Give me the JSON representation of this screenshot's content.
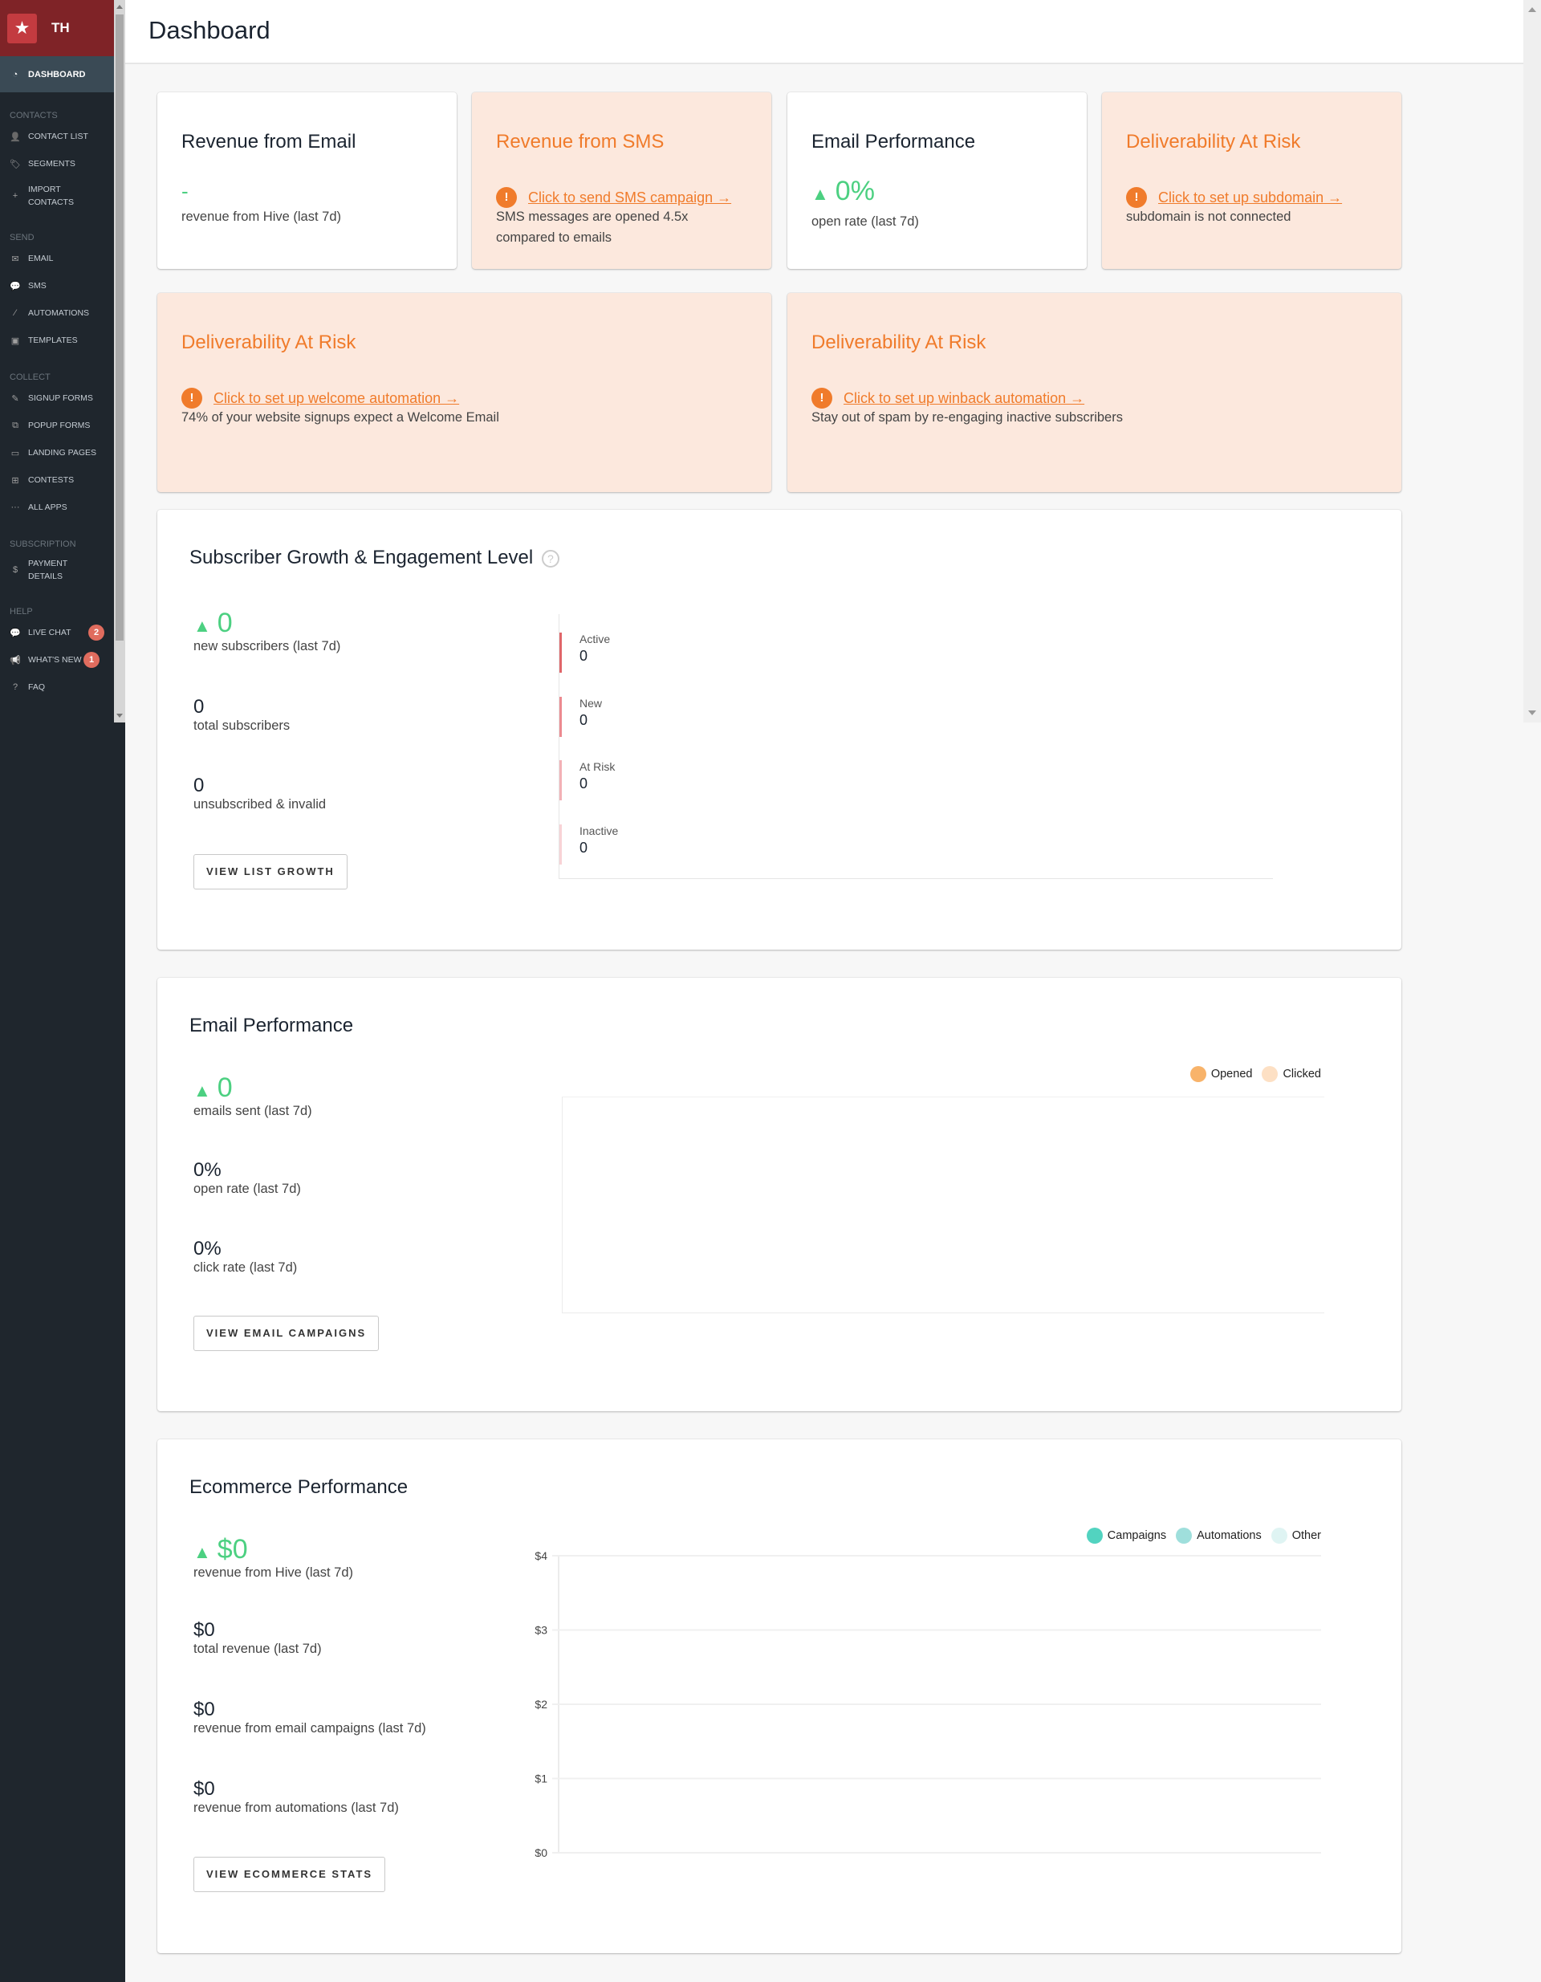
{
  "brand": {
    "initials": "TH",
    "logo_icon": "star-icon"
  },
  "sidebar": {
    "active": {
      "label": "DASHBOARD",
      "icon": "dashboard-gauge-icon"
    },
    "sections": [
      {
        "title": "CONTACTS",
        "items": [
          {
            "label": "CONTACT LIST",
            "icon": "user-icon"
          },
          {
            "label": "SEGMENTS",
            "icon": "tags-icon"
          },
          {
            "label": "IMPORT CONTACTS",
            "label_lines": [
              "IMPORT",
              "CONTACTS"
            ],
            "icon": "user-plus-icon"
          }
        ]
      },
      {
        "title": "SEND",
        "items": [
          {
            "label": "EMAIL",
            "icon": "envelope-icon"
          },
          {
            "label": "SMS",
            "icon": "chat-bubble-icon"
          },
          {
            "label": "AUTOMATIONS",
            "icon": "magic-wand-icon"
          },
          {
            "label": "TEMPLATES",
            "icon": "image-file-icon"
          }
        ]
      },
      {
        "title": "COLLECT",
        "items": [
          {
            "label": "SIGNUP FORMS",
            "icon": "edit-form-icon"
          },
          {
            "label": "POPUP FORMS",
            "icon": "popup-window-icon"
          },
          {
            "label": "LANDING PAGES",
            "icon": "browser-window-icon"
          },
          {
            "label": "CONTESTS",
            "icon": "gift-icon"
          },
          {
            "label": "ALL APPS",
            "icon": "ellipsis-icon"
          }
        ]
      },
      {
        "title": "SUBSCRIPTION",
        "items": [
          {
            "label": "PAYMENT DETAILS",
            "label_lines": [
              "PAYMENT",
              "DETAILS"
            ],
            "icon": "dollar-icon"
          }
        ]
      },
      {
        "title": "HELP",
        "items": [
          {
            "label": "LIVE CHAT",
            "icon": "chat-bubble-icon",
            "badge": "2"
          },
          {
            "label": "WHAT'S NEW",
            "icon": "megaphone-icon",
            "badge": "1"
          },
          {
            "label": "FAQ",
            "icon": "question-icon"
          }
        ]
      }
    ]
  },
  "header": {
    "title": "Dashboard"
  },
  "top_cards": [
    {
      "title": "Revenue from Email",
      "value": "-",
      "label": "revenue from Hive (last 7d)",
      "warn": false
    },
    {
      "title": "Revenue from SMS",
      "link": "Click to send SMS campaign →",
      "desc": "SMS messages are opened 4.5x compared to emails",
      "warn": true
    },
    {
      "title": "Email Performance",
      "value": "0%",
      "label": "open rate (last 7d)",
      "warn": false
    },
    {
      "title": "Deliverability At Risk",
      "link": "Click to set up subdomain →",
      "desc": "subdomain is not connected",
      "warn": true
    }
  ],
  "wide_cards": [
    {
      "title": "Deliverability At Risk",
      "link": "Click to set up welcome automation →",
      "desc": "74% of your website signups expect a Welcome Email"
    },
    {
      "title": "Deliverability At Risk",
      "link": "Click to set up winback automation →",
      "desc": "Stay out of spam by re-engaging inactive subscribers"
    }
  ],
  "subscriber": {
    "title": "Subscriber Growth & Engagement Level",
    "help_icon": "question-circle-icon",
    "stats": [
      {
        "value": "0",
        "label": "new subscribers (last 7d)",
        "trend": "up"
      },
      {
        "value": "0",
        "label": "total subscribers"
      },
      {
        "value": "0",
        "label": "unsubscribed & invalid"
      }
    ],
    "button": "VIEW LIST GROWTH",
    "engagement": [
      {
        "label": "Active",
        "value": "0",
        "color": "#e0666a"
      },
      {
        "label": "New",
        "value": "0",
        "color": "#ec8a90"
      },
      {
        "label": "At Risk",
        "value": "0",
        "color": "#f3b1b6"
      },
      {
        "label": "Inactive",
        "value": "0",
        "color": "#f8d3d6"
      }
    ]
  },
  "email_perf": {
    "title": "Email Performance",
    "stats": [
      {
        "value": "0",
        "label": "emails sent (last 7d)",
        "trend": "up"
      },
      {
        "value": "0%",
        "label": "open rate (last 7d)"
      },
      {
        "value": "0%",
        "label": "click rate (last 7d)"
      }
    ],
    "button": "VIEW EMAIL CAMPAIGNS",
    "legend": [
      {
        "label": "Opened",
        "color": "#f8b36a"
      },
      {
        "label": "Clicked",
        "color": "#fde0c4"
      }
    ]
  },
  "ecommerce": {
    "title": "Ecommerce Performance",
    "stats": [
      {
        "value": "$0",
        "label": "revenue from Hive (last 7d)",
        "trend": "up"
      },
      {
        "value": "$0",
        "label": "total revenue (last 7d)"
      },
      {
        "value": "$0",
        "label": "revenue from email campaigns (last 7d)"
      },
      {
        "value": "$0",
        "label": "revenue from automations (last 7d)"
      }
    ],
    "button": "VIEW ECOMMERCE STATS",
    "legend": [
      {
        "label": "Campaigns",
        "color": "#52d3c0"
      },
      {
        "label": "Automations",
        "color": "#9fdfdc"
      },
      {
        "label": "Other",
        "color": "#dff4f3"
      }
    ]
  },
  "chart_data": [
    {
      "type": "bar",
      "title": "Email Performance",
      "series": [
        {
          "name": "Opened",
          "values": []
        },
        {
          "name": "Clicked",
          "values": []
        }
      ],
      "categories": [],
      "legend": "top-right",
      "grid": false
    },
    {
      "type": "bar",
      "title": "Ecommerce Performance",
      "series": [
        {
          "name": "Campaigns",
          "values": []
        },
        {
          "name": "Automations",
          "values": []
        },
        {
          "name": "Other",
          "values": []
        }
      ],
      "categories": [],
      "yticks": [
        "$0",
        "$1",
        "$2",
        "$3",
        "$4"
      ],
      "ylim": [
        0,
        4
      ],
      "xlabel": "",
      "ylabel": "",
      "legend": "top-right",
      "grid": true
    }
  ]
}
